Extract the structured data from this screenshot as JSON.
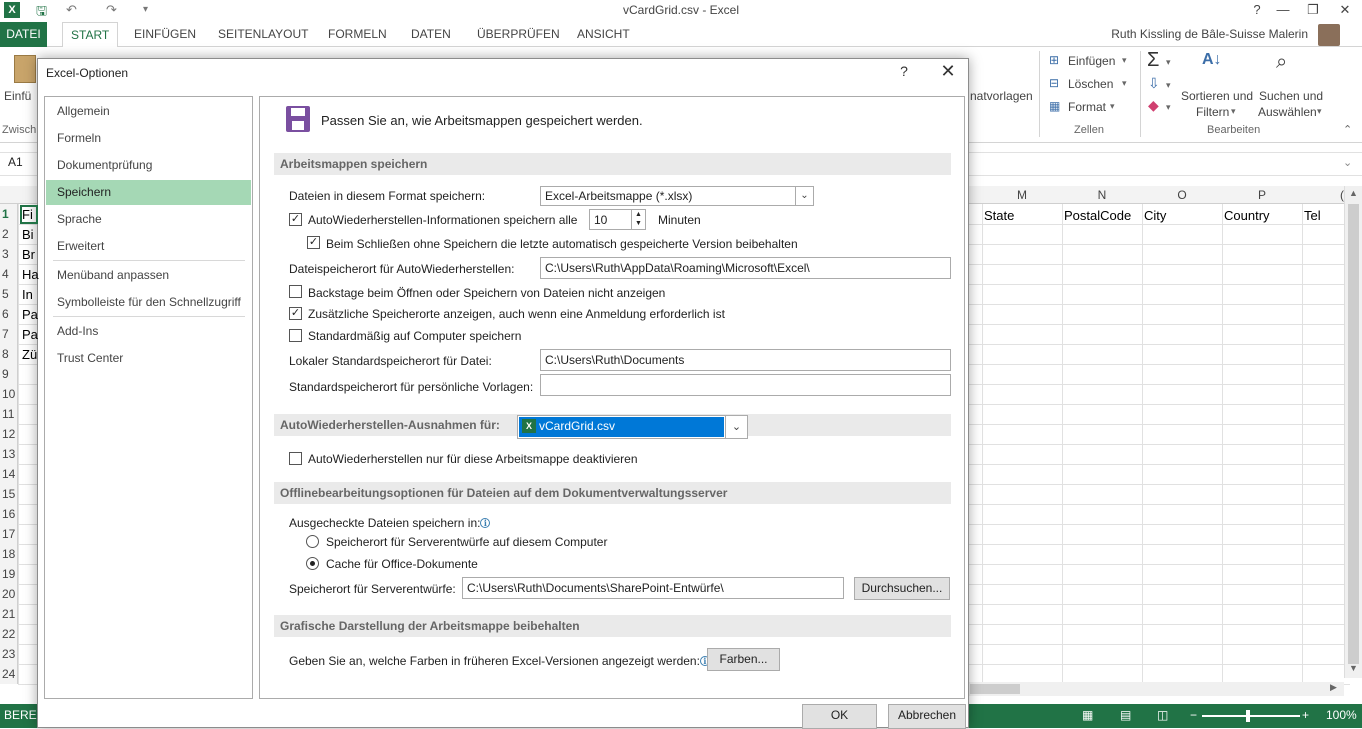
{
  "window": {
    "title": "vCardGrid.csv - Excel",
    "user": "Ruth Kissling de Bâle-Suisse Malerin"
  },
  "ribbon": {
    "tabs": [
      "DATEI",
      "START",
      "EINFÜGEN",
      "SEITENLAYOUT",
      "FORMELN",
      "DATEN",
      "ÜBERPRÜFEN",
      "ANSICHT"
    ],
    "left_paste": "Einfü",
    "left_clipboard": "Zwisch",
    "format_templates": "natvorlagen",
    "cells_insert": "Einfügen",
    "cells_delete": "Löschen",
    "cells_format": "Format",
    "cells_group": "Zellen",
    "sort_filter_1": "Sortieren und",
    "sort_filter_2": "Filtern",
    "find_select_1": "Suchen und",
    "find_select_2": "Auswählen",
    "edit_group": "Bearbeiten"
  },
  "sheet": {
    "namebox": "A1",
    "col_letters": [
      "M",
      "N",
      "O",
      "P",
      "("
    ],
    "header_cells": [
      "State",
      "PostalCode",
      "City",
      "Country",
      "Tel"
    ],
    "row_numbers": [
      "1",
      "2",
      "3",
      "4",
      "5",
      "6",
      "7",
      "8",
      "9",
      "10",
      "11",
      "12",
      "13",
      "14",
      "15",
      "16",
      "17",
      "18",
      "19",
      "20",
      "21",
      "22",
      "23",
      "24"
    ],
    "a_cells": [
      "Fi",
      "Bi",
      "Br",
      "Ha",
      "In",
      "Pa",
      "Pa",
      "Zü"
    ],
    "status_ready": "BEREIT",
    "zoom": "100%"
  },
  "dialog": {
    "title": "Excel-Optionen",
    "help": "?",
    "close": "✕",
    "nav": [
      "Allgemein",
      "Formeln",
      "Dokumentprüfung",
      "Speichern",
      "Sprache",
      "Erweitert",
      "Menüband anpassen",
      "Symbolleiste für den Schnellzugriff",
      "Add-Ins",
      "Trust Center"
    ],
    "intro": "Passen Sie an, wie Arbeitsmappen gespeichert werden.",
    "sec1": "Arbeitsmappen speichern",
    "format_label": "Dateien in diesem Format speichern:",
    "format_value": "Excel-Arbeitsmappe (*.xlsx)",
    "autorecover_label": "AutoWiederherstellen-Informationen speichern alle",
    "autorecover_minutes": "10",
    "minutes_label": "Minuten",
    "keep_last_label": "Beim Schließen ohne Speichern die letzte automatisch gespeicherte Version beibehalten",
    "autorecover_loc_label": "Dateispeicherort für AutoWiederherstellen:",
    "autorecover_loc_value": "C:\\Users\\Ruth\\AppData\\Roaming\\Microsoft\\Excel\\",
    "backstage_label": "Backstage beim Öffnen oder Speichern von Dateien nicht anzeigen",
    "extra_locations_label": "Zusätzliche Speicherorte anzeigen, auch wenn eine Anmeldung erforderlich ist",
    "default_computer_label": "Standardmäßig auf Computer speichern",
    "local_default_label": "Lokaler Standardspeicherort für Datei:",
    "local_default_value": "C:\\Users\\Ruth\\Documents",
    "templates_label": "Standardspeicherort für persönliche Vorlagen:",
    "templates_value": "",
    "sec2": "AutoWiederherstellen-Ausnahmen für:",
    "exception_value": "vCardGrid.csv",
    "disable_autorecover_label": "AutoWiederherstellen nur für diese Arbeitsmappe deaktivieren",
    "sec3": "Offlinebearbeitungsoptionen für Dateien auf dem Dokumentverwaltungsserver",
    "checked_out_label": "Ausgecheckte Dateien speichern in:",
    "radio1_label": "Speicherort für Serverentwürfe auf diesem Computer",
    "radio2_label": "Cache für Office-Dokumente",
    "server_drafts_label": "Speicherort für Serverentwürfe:",
    "server_drafts_value": "C:\\Users\\Ruth\\Documents\\SharePoint-Entwürfe\\",
    "browse_button": "Durchsuchen...",
    "sec4": "Grafische Darstellung der Arbeitsmappe beibehalten",
    "colors_label": "Geben Sie an, welche Farben in früheren Excel-Versionen angezeigt werden:",
    "colors_button": "Farben...",
    "ok_button": "OK",
    "cancel_button": "Abbrechen"
  },
  "colors": {
    "excel_green": "#217346",
    "nav_selected": "#a5d8b5",
    "combo_selected": "#0078d7"
  }
}
